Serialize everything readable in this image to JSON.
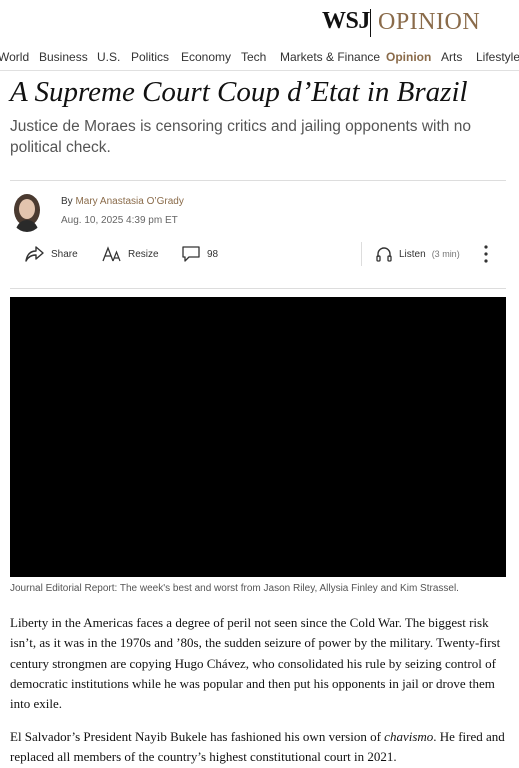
{
  "masthead": {
    "logo": "WSJ",
    "section": "OPINION"
  },
  "nav": [
    {
      "label": "World"
    },
    {
      "label": "Business"
    },
    {
      "label": "U.S."
    },
    {
      "label": "Politics"
    },
    {
      "label": "Economy"
    },
    {
      "label": "Tech"
    },
    {
      "label": "Markets & Finance"
    },
    {
      "label": "Opinion",
      "active": true
    },
    {
      "label": "Arts"
    },
    {
      "label": "Lifestyle"
    }
  ],
  "article": {
    "headline": "A Supreme Court Coup d’Etat in Brazil",
    "dek": "Justice de Moraes is censoring critics and jailing opponents with no political check.",
    "byline_prefix": "By",
    "author": "Mary Anastasia O’Grady",
    "date": "Aug. 10, 2025 4:39 pm ET"
  },
  "toolbar": {
    "share_label": "Share",
    "resize_label": "Resize",
    "comments_count": "98",
    "listen_label": "Listen",
    "listen_duration": "(3 min)"
  },
  "video": {
    "caption": "Journal Editorial Report: The week's best and worst from Jason Riley, Allysia Finley and Kim Strassel."
  },
  "body": {
    "p1": "Liberty in the Americas faces a degree of peril not seen since the Cold War. The biggest risk isn’t, as it was in the 1970s and ’80s, the sudden seizure of power by the military. Twenty-first century strongmen are copying Hugo Chávez, who consolidated his rule by seizing control of democratic institutions while he was popular and then put his opponents in jail or drove them into exile.",
    "p2_before": "El Salvador’s President Nayib Bukele has fashioned his own version of ",
    "p2_em": "chavismo",
    "p2_after": ". He fired and replaced all members of the country’s highest constitutional court in 2021."
  },
  "icons": {
    "share": "share-icon",
    "resize": "text-resize-icon",
    "comments": "comment-icon",
    "listen": "headphones-icon",
    "more": "more-vertical-icon"
  },
  "colors": {
    "accent": "#8a6b4a",
    "text": "#111111",
    "muted": "#555555"
  }
}
